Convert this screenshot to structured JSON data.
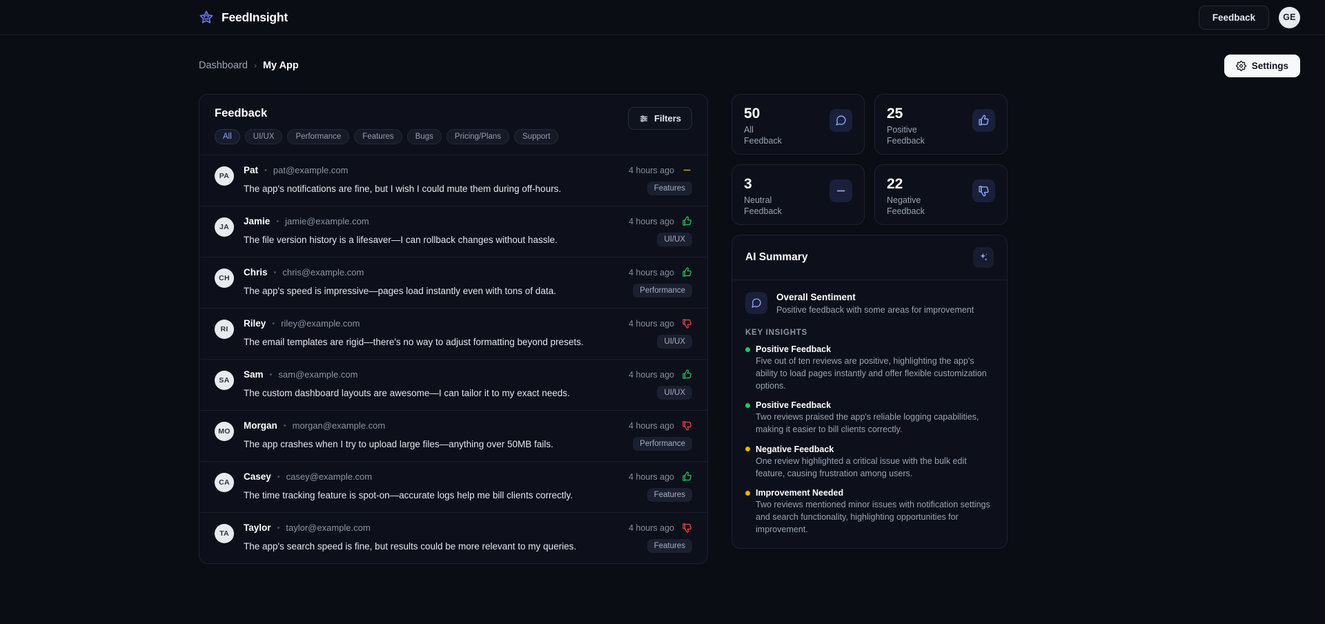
{
  "app": {
    "brand": "FeedInsight",
    "logo_icon": "star-icon",
    "feedback_button": "Feedback",
    "avatar_initials": "GE"
  },
  "breadcrumb": {
    "root": "Dashboard",
    "separator": "›",
    "current": "My App"
  },
  "settings_button": {
    "label": "Settings",
    "icon": "gear-icon"
  },
  "feedback_panel": {
    "title": "Feedback",
    "filters_button": {
      "label": "Filters",
      "icon": "sliders-icon"
    },
    "chips": [
      {
        "label": "All",
        "active": true
      },
      {
        "label": "UI/UX",
        "active": false
      },
      {
        "label": "Performance",
        "active": false
      },
      {
        "label": "Features",
        "active": false
      },
      {
        "label": "Bugs",
        "active": false
      },
      {
        "label": "Pricing/Plans",
        "active": false
      },
      {
        "label": "Support",
        "active": false
      }
    ],
    "rows": [
      {
        "initials": "PA",
        "name": "Pat",
        "email": "pat@example.com",
        "time": "4 hours ago",
        "sentiment": "neutral",
        "text": "The app's notifications are fine, but I wish I could mute them during off-hours.",
        "tag": "Features"
      },
      {
        "initials": "JA",
        "name": "Jamie",
        "email": "jamie@example.com",
        "time": "4 hours ago",
        "sentiment": "positive",
        "text": "The file version history is a lifesaver—I can rollback changes without hassle.",
        "tag": "UI/UX"
      },
      {
        "initials": "CH",
        "name": "Chris",
        "email": "chris@example.com",
        "time": "4 hours ago",
        "sentiment": "positive",
        "text": "The app's speed is impressive—pages load instantly even with tons of data.",
        "tag": "Performance"
      },
      {
        "initials": "RI",
        "name": "Riley",
        "email": "riley@example.com",
        "time": "4 hours ago",
        "sentiment": "negative",
        "text": "The email templates are rigid—there's no way to adjust formatting beyond presets.",
        "tag": "UI/UX"
      },
      {
        "initials": "SA",
        "name": "Sam",
        "email": "sam@example.com",
        "time": "4 hours ago",
        "sentiment": "positive",
        "text": "The custom dashboard layouts are awesome—I can tailor it to my exact needs.",
        "tag": "UI/UX"
      },
      {
        "initials": "MO",
        "name": "Morgan",
        "email": "morgan@example.com",
        "time": "4 hours ago",
        "sentiment": "negative",
        "text": "The app crashes when I try to upload large files—anything over 50MB fails.",
        "tag": "Performance"
      },
      {
        "initials": "CA",
        "name": "Casey",
        "email": "casey@example.com",
        "time": "4 hours ago",
        "sentiment": "positive",
        "text": "The time tracking feature is spot-on—accurate logs help me bill clients correctly.",
        "tag": "Features"
      },
      {
        "initials": "TA",
        "name": "Taylor",
        "email": "taylor@example.com",
        "time": "4 hours ago",
        "sentiment": "negative",
        "text": "The app's search speed is fine, but results could be more relevant to my queries.",
        "tag": "Features"
      }
    ]
  },
  "stats": [
    {
      "value": "50",
      "label": "All\nFeedback",
      "icon": "chat-bubble-icon"
    },
    {
      "value": "25",
      "label": "Positive\nFeedback",
      "icon": "thumbs-up-icon"
    },
    {
      "value": "3",
      "label": "Neutral\nFeedback",
      "icon": "minus-icon"
    },
    {
      "value": "22",
      "label": "Negative\nFeedback",
      "icon": "thumbs-down-icon"
    }
  ],
  "ai_summary": {
    "title": "AI Summary",
    "header_icon": "sparkles-icon",
    "overall": {
      "icon": "chat-bubble-icon",
      "title": "Overall Sentiment",
      "description": "Positive feedback with some areas for improvement"
    },
    "insights_label": "KEY INSIGHTS",
    "insights": [
      {
        "dot_color": "#22c55e",
        "title": "Positive Feedback",
        "text": "Five out of ten reviews are positive, highlighting the app's ability to load pages instantly and offer flexible customization options."
      },
      {
        "dot_color": "#22c55e",
        "title": "Positive Feedback",
        "text": "Two reviews praised the app's reliable logging capabilities, making it easier to bill clients correctly."
      },
      {
        "dot_color": "#eab308",
        "title": "Negative Feedback",
        "text": "One review highlighted a critical issue with the bulk edit feature, causing frustration among users."
      },
      {
        "dot_color": "#eab308",
        "title": "Improvement Needed",
        "text": "Two reviews mentioned minor issues with notification settings and search functionality, highlighting opportunities for improvement."
      }
    ]
  },
  "colors": {
    "page_bg": "#0b0d14",
    "card_bg": "#0d101a",
    "border": "#1d2130",
    "accent": "#8ea4ff",
    "positive": "#22c55e",
    "negative": "#ef4444",
    "neutral": "#d99a2b"
  }
}
